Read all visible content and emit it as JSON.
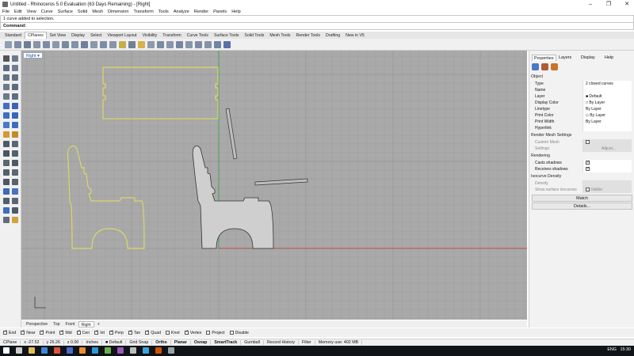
{
  "app": {
    "title": "Untitled - Rhinoceros 5.0 Evaluation (63 Days Remaining) - [Right]"
  },
  "menu": [
    "File",
    "Edit",
    "View",
    "Curve",
    "Surface",
    "Solid",
    "Mesh",
    "Dimension",
    "Transform",
    "Tools",
    "Analyze",
    "Render",
    "Panels",
    "Help"
  ],
  "command": {
    "history": "1 curve added to selection.",
    "prompt": "Command:"
  },
  "toolbar_tabs": [
    "Standard",
    "CPlanes",
    "Set View",
    "Display",
    "Select",
    "Viewport Layout",
    "Visibility",
    "Transform",
    "Curve Tools",
    "Surface Tools",
    "Solid Tools",
    "Mesh Tools",
    "Render Tools",
    "Drafting",
    "New in V5"
  ],
  "active_toolbar_tab": "CPlanes",
  "viewport": {
    "label": "Right"
  },
  "viewport_tabs": [
    "Perspective",
    "Top",
    "Front",
    "Right"
  ],
  "active_viewport_tab": "Right",
  "panel": {
    "tabs": [
      "Properties",
      "Layers",
      "Display",
      "Help"
    ],
    "object_section": "Object",
    "rows": [
      {
        "k": "Type",
        "v": "2 closed curves"
      },
      {
        "k": "Name",
        "v": ""
      },
      {
        "k": "Layer",
        "v": "Default"
      },
      {
        "k": "Display Color",
        "v": "By Layer"
      },
      {
        "k": "Linetype",
        "v": "By Layer"
      },
      {
        "k": "Print Color",
        "v": "By Layer"
      },
      {
        "k": "Print Width",
        "v": "By Layer"
      },
      {
        "k": "Hyperlink",
        "v": ""
      }
    ],
    "render_mesh_section": "Render Mesh Settings",
    "custom_mesh_label": "Custom Mesh",
    "settings_label": "Settings",
    "adjust_label": "Adjust...",
    "rendering_section": "Rendering",
    "casts_shadows": "Casts shadows",
    "receives_shadows": "Receives shadows",
    "isocurve_section": "Isocurve Density",
    "density_label": "Density",
    "show_iso_label": "Show surface isocurves",
    "visible_label": "Visible",
    "match_button": "Match",
    "details_button": "Details..."
  },
  "osnaps": [
    {
      "label": "End",
      "on": true
    },
    {
      "label": "Near",
      "on": true
    },
    {
      "label": "Point",
      "on": true
    },
    {
      "label": "Mid",
      "on": true
    },
    {
      "label": "Cen",
      "on": true
    },
    {
      "label": "Int",
      "on": true
    },
    {
      "label": "Perp",
      "on": true
    },
    {
      "label": "Tan",
      "on": true
    },
    {
      "label": "Quad",
      "on": true
    },
    {
      "label": "Knot",
      "on": false
    },
    {
      "label": "Vertex",
      "on": true
    },
    {
      "label": "Project",
      "on": false
    },
    {
      "label": "Disable",
      "on": false
    }
  ],
  "status": {
    "cplane": "CPlane",
    "x": "x -27.52",
    "y": "y 26.26",
    "z": "z 0.00",
    "units": "Inches",
    "layer": "Default",
    "grid_snap": "Grid Snap",
    "ortho": "Ortho",
    "planar": "Planar",
    "osnap": "Osnap",
    "smarttrack": "SmartTrack",
    "gumball": "Gumball",
    "record_history": "Record History",
    "filter": "Filter",
    "memory": "Memory use: 402 MB"
  },
  "taskbar": {
    "lang": "ENG",
    "time": "15:30"
  },
  "colors": {
    "viewport_bg": "#a9a9a9",
    "grid_line": "#9b9b9b",
    "grid_major": "#8e8e8e",
    "selected_curve": "#d8d86a",
    "x_axis": "#c0392b",
    "y_axis": "#2e9e4a",
    "shape_fill": "#cfcfcf"
  }
}
